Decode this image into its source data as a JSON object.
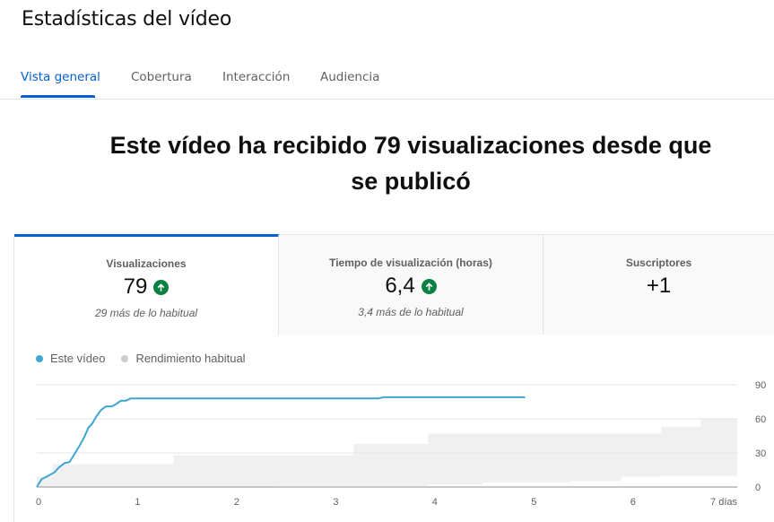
{
  "header": {
    "title": "Estadísticas del vídeo"
  },
  "tabs": [
    {
      "label": "Vista general",
      "active": true
    },
    {
      "label": "Cobertura",
      "active": false
    },
    {
      "label": "Interacción",
      "active": false
    },
    {
      "label": "Audiencia",
      "active": false
    }
  ],
  "headline": "Este vídeo ha recibido 79 visualizaciones desde que se publicó",
  "metrics": [
    {
      "label": "Visualizaciones",
      "value": "79",
      "trend": "up",
      "sub": "29 más de lo habitual",
      "active": true
    },
    {
      "label": "Tiempo de visualización (horas)",
      "value": "6,4",
      "trend": "up",
      "sub": "3,4 más de lo habitual",
      "active": false
    },
    {
      "label": "Suscriptores",
      "value": "+1",
      "trend": "none",
      "sub": "",
      "active": false
    }
  ],
  "colors": {
    "accent": "#065fd4",
    "series_video": "#3ea6cf",
    "band": "#f0f0f0",
    "trend_up": "#0b8043"
  },
  "chart_data": {
    "type": "line",
    "legend": [
      {
        "name": "Este vídeo",
        "color": "#3ea6cf"
      },
      {
        "name": "Rendimiento habitual",
        "color": "#cccccc"
      }
    ],
    "x_ticks": [
      "0",
      "1",
      "2",
      "3",
      "4",
      "5",
      "6",
      "7 días"
    ],
    "y_ticks": [
      "0",
      "30",
      "60",
      "90"
    ],
    "xlim": [
      0,
      7.07
    ],
    "ylim": [
      0,
      90
    ],
    "series": [
      {
        "name": "Este vídeo",
        "x": [
          0,
          0.05,
          0.12,
          0.18,
          0.22,
          0.28,
          0.33,
          0.38,
          0.43,
          0.48,
          0.52,
          0.56,
          0.6,
          0.65,
          0.7,
          0.76,
          0.8,
          0.85,
          0.9,
          0.95,
          1.0,
          1.5,
          2.0,
          2.5,
          3.0,
          3.45,
          3.5,
          4.0,
          4.5,
          4.93
        ],
        "y": [
          0,
          7,
          10,
          13,
          17,
          21,
          22,
          29,
          36,
          44,
          52,
          56,
          62,
          68,
          71,
          71,
          73,
          76,
          76,
          78,
          78,
          78,
          78,
          78,
          78,
          78,
          79,
          79,
          79,
          79
        ]
      }
    ],
    "typical_band": {
      "name": "Rendimiento habitual",
      "x": [
        0,
        0.16,
        1.05,
        1.38,
        2.4,
        3.2,
        3.95,
        4.5,
        5.38,
        5.9,
        6.3,
        6.7,
        7.07
      ],
      "low": [
        0,
        0,
        0,
        0,
        1,
        1,
        2,
        4,
        5,
        9,
        10,
        10,
        10
      ],
      "high": [
        9,
        20,
        20,
        28,
        28,
        38,
        47,
        47,
        47,
        47,
        53,
        60,
        60
      ]
    }
  }
}
